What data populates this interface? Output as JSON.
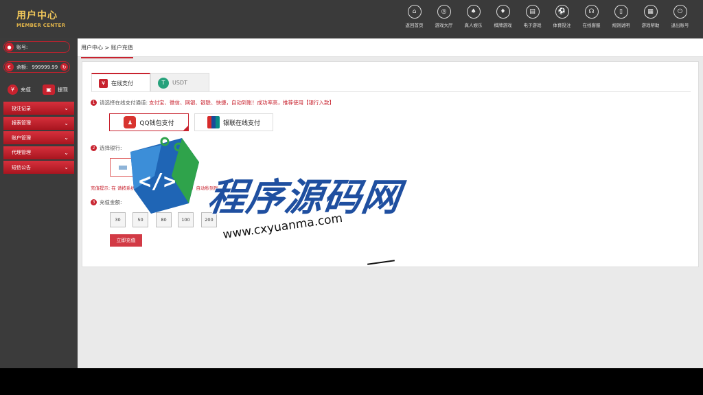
{
  "header": {
    "logo_cn": "用户中心",
    "logo_en": "MEMBER CENTER",
    "nav": [
      {
        "label": "返回首页",
        "icon": "home-icon",
        "glyph": "⌂"
      },
      {
        "label": "游戏大厅",
        "icon": "target-icon",
        "glyph": "◎"
      },
      {
        "label": "真人娱乐",
        "icon": "dealer-icon",
        "glyph": "♠"
      },
      {
        "label": "棋牌游戏",
        "icon": "cards-icon",
        "glyph": "♦"
      },
      {
        "label": "电子游戏",
        "icon": "slot-icon",
        "glyph": "▤"
      },
      {
        "label": "体育投注",
        "icon": "ball-icon",
        "glyph": "⚽"
      },
      {
        "label": "在线客服",
        "icon": "headset-icon",
        "glyph": "☊"
      },
      {
        "label": "规则说明",
        "icon": "doc-icon",
        "glyph": "▯"
      },
      {
        "label": "游戏帮助",
        "icon": "help-icon",
        "glyph": "▦"
      },
      {
        "label": "退出账号",
        "icon": "power-icon",
        "glyph": "⏻"
      }
    ]
  },
  "sidebar": {
    "account_label": "账号:",
    "balance_label": "余额:",
    "balance_value": "999999.99",
    "deposit_label": "充值",
    "withdraw_label": "提现",
    "menu": [
      "投注记录",
      "报表管理",
      "账户管理",
      "代理管理",
      "短信公告"
    ]
  },
  "main": {
    "breadcrumb": "用户中心 > 账户充值",
    "tabs": [
      {
        "label": "在线支付",
        "icon": "yuan-icon",
        "glyph": "¥"
      },
      {
        "label": "USDT",
        "icon": "tether-icon",
        "glyph": "T"
      }
    ],
    "step1_label": "请选择在线支付通道:",
    "step1_hint": "支付宝、微信、网银、银联、快捷，自动到账！成功率高，推荐使用【银行入款】",
    "pay_methods": [
      {
        "label": "QQ钱包支付",
        "icon": "qq-icon",
        "glyph": "♟"
      },
      {
        "label": "银联在线支付",
        "icon": "unionpay-icon",
        "glyph": ""
      }
    ],
    "step2_label": "选择银行:",
    "tip": "充值提示: 在                              请按系统支付          ，            后马上传图片，提交！自动秒到账。",
    "step3_label": "充值金额:",
    "amounts": [
      "30",
      "50",
      "80",
      "100",
      "200"
    ],
    "submit_label": "立即充值"
  },
  "watermark": {
    "title": "程序源码网",
    "url": "www.cxyuanma.com"
  }
}
